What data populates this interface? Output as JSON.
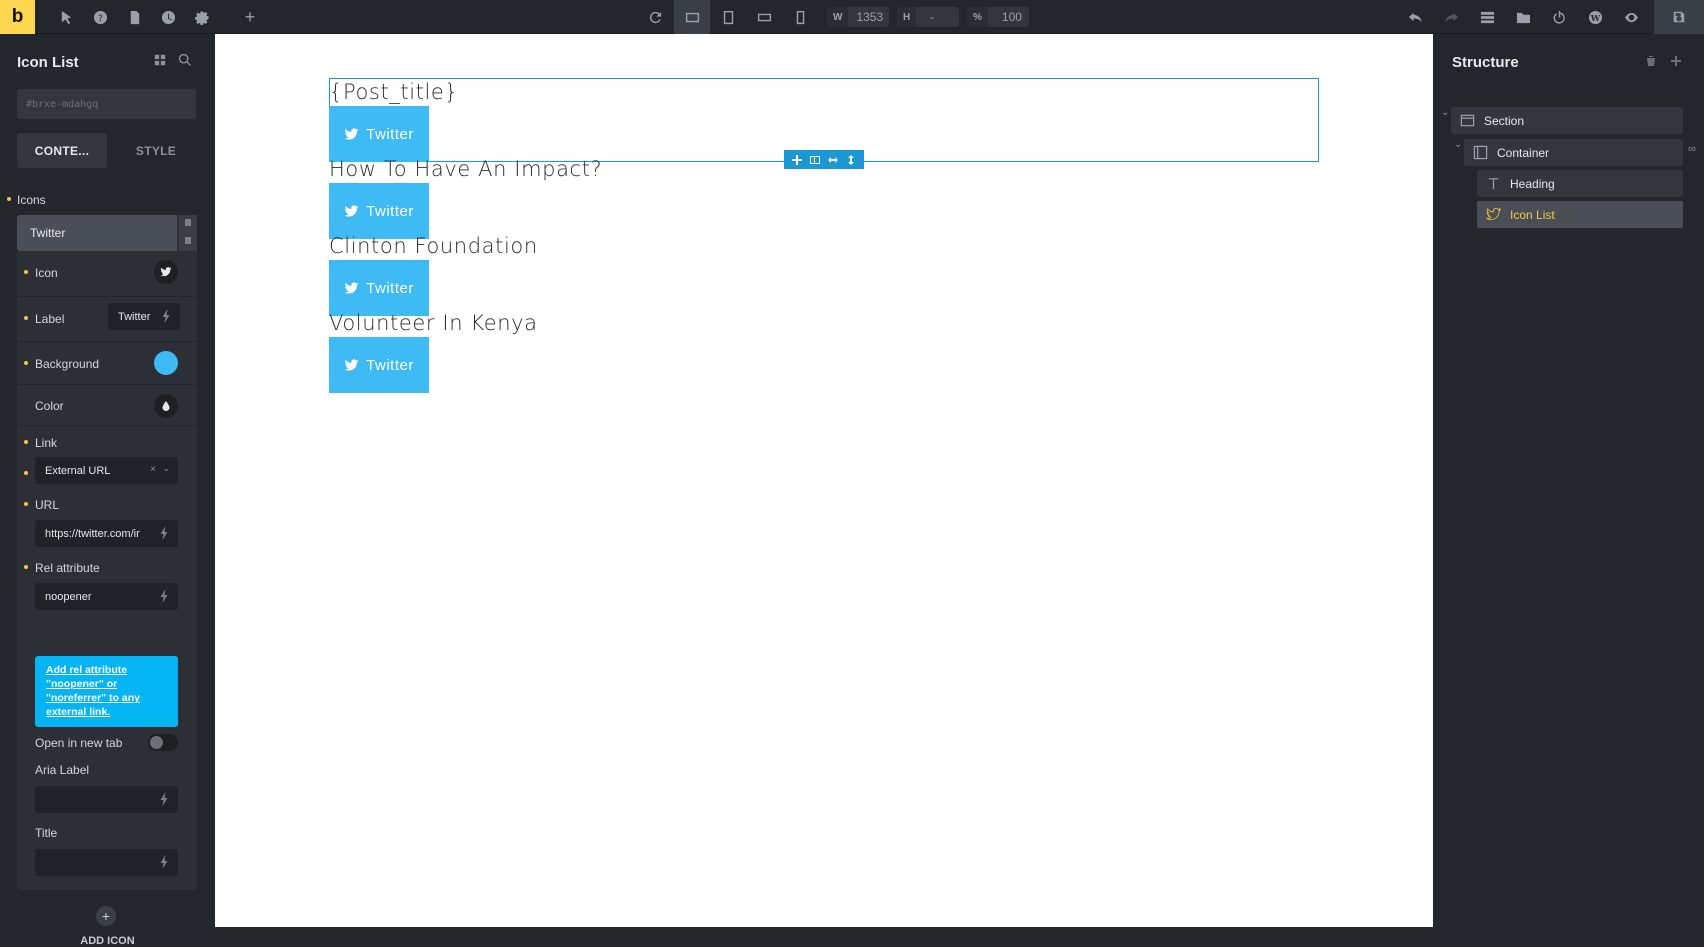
{
  "topbar": {
    "logo": "b",
    "width_label": "W",
    "width_value": "1353",
    "height_label": "H",
    "height_value": "-",
    "zoom_label": "%",
    "zoom_value": "100"
  },
  "left_panel": {
    "title": "Icon List",
    "element_id": "#brxe-mdahgq",
    "tabs": [
      "CONTE...",
      "STYLE"
    ],
    "section_label": "Icons",
    "item_title": "Twitter",
    "fields": {
      "icon_label": "Icon",
      "label_label": "Label",
      "label_value": "Twitter",
      "background_label": "Background",
      "background_color": "#3ebaf4",
      "color_label": "Color",
      "link_label": "Link",
      "link_type": "External URL",
      "url_label": "URL",
      "url_value": "https://twitter.com/ir",
      "rel_label": "Rel attribute",
      "rel_value": "noopener",
      "rel_info": "Add rel attribute \"noopener\" or \"noreferrer\" to any external link.",
      "new_tab_label": "Open in new tab",
      "aria_label": "Aria Label",
      "title_label": "Title"
    },
    "add_icon": "ADD ICON"
  },
  "canvas": {
    "posts": [
      {
        "title": "{Post_title}",
        "button": "Twitter"
      },
      {
        "title": "How To Have An Impact?",
        "button": "Twitter"
      },
      {
        "title": "Clinton Foundation",
        "button": "Twitter"
      },
      {
        "title": "Volunteer In Kenya",
        "button": "Twitter"
      }
    ],
    "accent": "#1a98d6"
  },
  "structure": {
    "title": "Structure",
    "nodes": [
      "Section",
      "Container",
      "Heading",
      "Icon List"
    ]
  }
}
